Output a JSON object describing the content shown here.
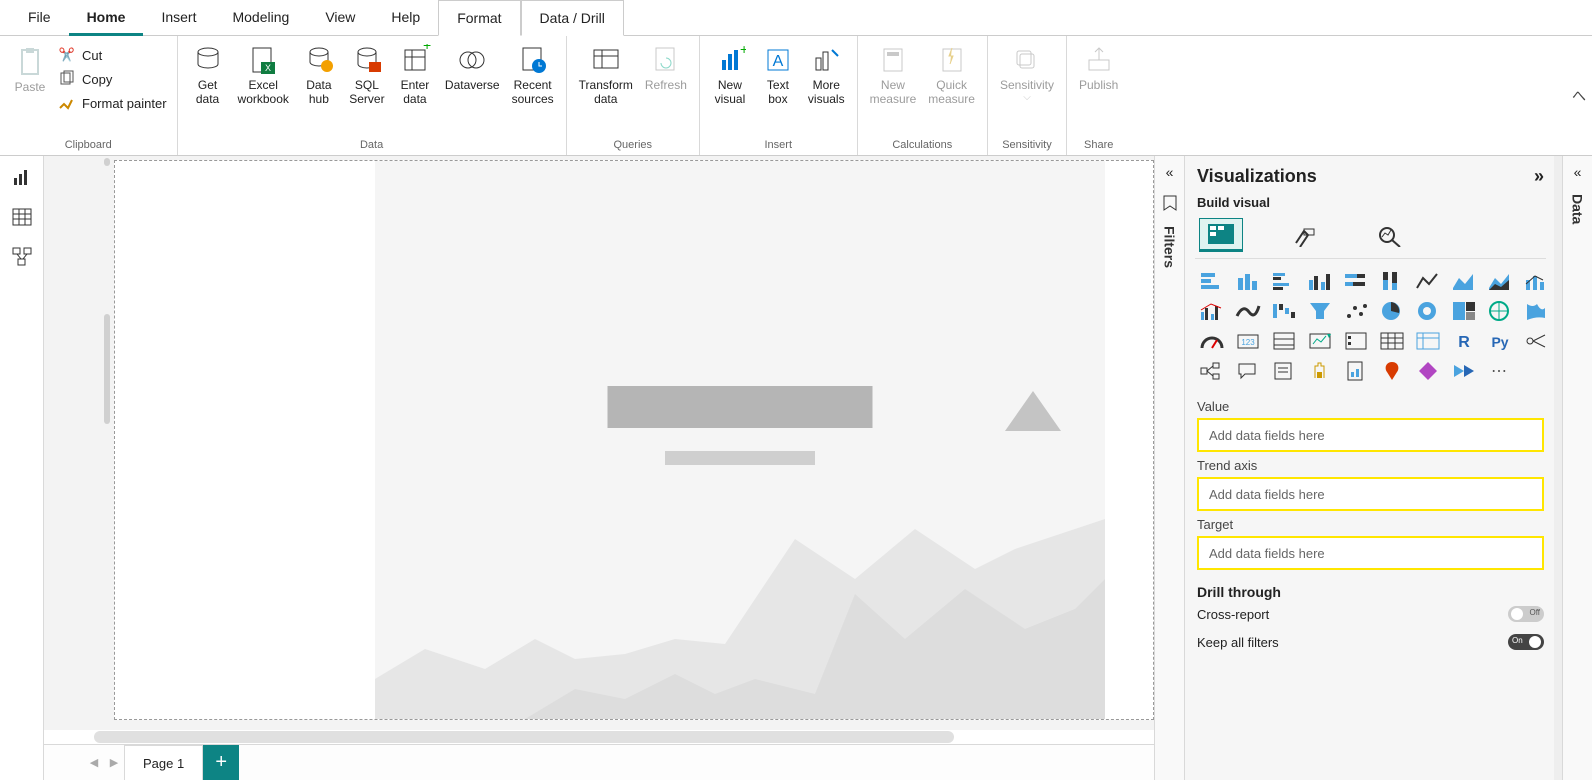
{
  "menu": {
    "tabs": [
      "File",
      "Home",
      "Insert",
      "Modeling",
      "View",
      "Help",
      "Format",
      "Data / Drill"
    ],
    "active": "Home",
    "context": [
      "Format",
      "Data / Drill"
    ]
  },
  "ribbon": {
    "clipboard": {
      "paste": "Paste",
      "cut": "Cut",
      "copy": "Copy",
      "format_painter": "Format painter",
      "group": "Clipboard"
    },
    "data": {
      "get_data": "Get\ndata",
      "excel": "Excel\nworkbook",
      "data_hub": "Data\nhub",
      "sql": "SQL\nServer",
      "enter_data": "Enter\ndata",
      "dataverse": "Dataverse",
      "recent": "Recent\nsources",
      "group": "Data"
    },
    "queries": {
      "transform": "Transform\ndata",
      "refresh": "Refresh",
      "group": "Queries"
    },
    "insert": {
      "new_visual": "New\nvisual",
      "text_box": "Text\nbox",
      "more_visuals": "More\nvisuals",
      "group": "Insert"
    },
    "calculations": {
      "new_measure": "New\nmeasure",
      "quick_measure": "Quick\nmeasure",
      "group": "Calculations"
    },
    "sensitivity": {
      "btn": "Sensitivity",
      "group": "Sensitivity"
    },
    "share": {
      "publish": "Publish",
      "group": "Share"
    }
  },
  "filters_label": "Filters",
  "viz": {
    "header": "Visualizations",
    "sub": "Build visual",
    "fields": {
      "value": {
        "label": "Value",
        "placeholder": "Add data fields here"
      },
      "trend": {
        "label": "Trend axis",
        "placeholder": "Add data fields here"
      },
      "target": {
        "label": "Target",
        "placeholder": "Add data fields here"
      }
    },
    "drill": "Drill through",
    "cross_report": "Cross-report",
    "keep_filters": "Keep all filters",
    "toggle_off": "Off",
    "toggle_on": "On"
  },
  "data_label": "Data",
  "pages": {
    "page1": "Page 1"
  }
}
